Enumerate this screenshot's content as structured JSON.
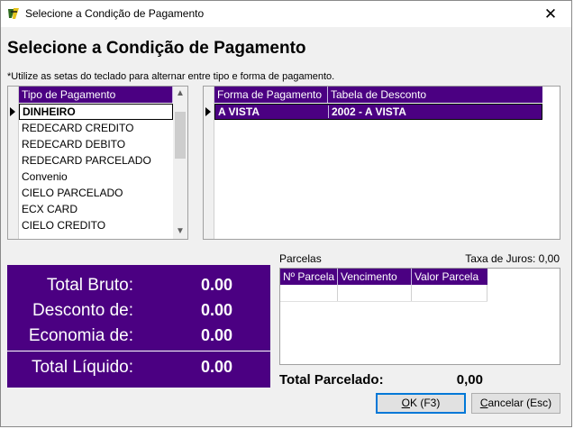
{
  "window": {
    "title": "Selecione a Condição de Pagamento",
    "close_glyph": "✕"
  },
  "heading": "Selecione a Condição de Pagamento",
  "hint": "*Utilize as setas do teclado para alternar entre tipo e forma de pagamento.",
  "tipo_pagamento": {
    "header": "Tipo de Pagamento",
    "items": [
      "DINHEIRO",
      "REDECARD CREDITO",
      "REDECARD DEBITO",
      "REDECARD PARCELADO",
      "Convenio",
      "CIELO PARCELADO",
      "ECX CARD",
      "CIELO CREDITO"
    ],
    "selected": "DINHEIRO"
  },
  "forma_pagamento": {
    "columns": [
      "Forma de Pagamento",
      "Tabela de Desconto"
    ],
    "rows": [
      {
        "forma": "A VISTA",
        "tabela": "2002 - A VISTA"
      }
    ]
  },
  "totals": {
    "bruto_label": "Total Bruto:",
    "bruto_value": "0.00",
    "desconto_label": "Desconto de:",
    "desconto_value": "0.00",
    "economia_label": "Economia de:",
    "economia_value": "0.00",
    "liquido_label": "Total Líquido:",
    "liquido_value": "0.00"
  },
  "parcelas": {
    "label": "Parcelas",
    "taxa_label": "Taxa de Juros: 0,00",
    "columns": [
      "Nº Parcela",
      "Vencimento",
      "Valor Parcela"
    ],
    "total_label": "Total Parcelado:",
    "total_value": "0,00"
  },
  "buttons": {
    "ok_prefix": "",
    "ok_hotkey": "O",
    "ok_rest": "K (F3)",
    "cancel_prefix": "",
    "cancel_hotkey": "C",
    "cancel_rest": "ancelar (Esc)"
  },
  "colors": {
    "accent": "#4b0082",
    "accent_text": "#ffffff"
  }
}
